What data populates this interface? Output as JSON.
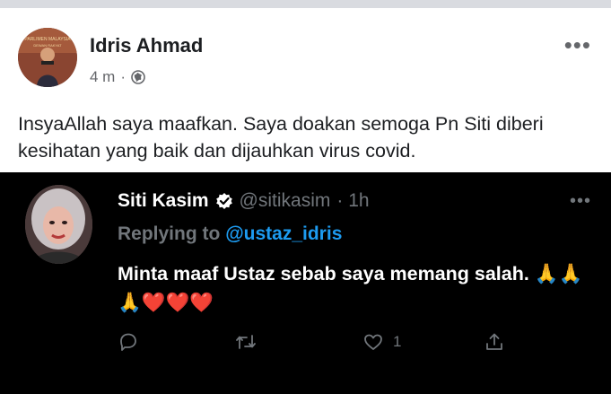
{
  "fb_post": {
    "author": "Idris Ahmad",
    "time": "4 m",
    "separator": "·",
    "audience_icon": "globe-icon",
    "more_icon": "more-horizontal-icon",
    "avatar_caption": "PARLIMEN MALAYSIA DEWAN RAKYAT",
    "text": "InsyaAllah  saya maafkan. Saya doakan semoga Pn Siti diberi kesihatan yang baik dan dijauhkan virus covid."
  },
  "tweet": {
    "name": "Siti Kasim",
    "verified_icon": "verified-badge-icon",
    "handle": "@sitikasim",
    "time": "· 1h",
    "replying_label": "Replying to",
    "replying_to": "@ustaz_idris",
    "text": "Minta maaf Ustaz sebab saya memang salah. 🙏🙏🙏❤️❤️❤️",
    "more_icon": "more-horizontal-icon",
    "actions": {
      "reply_icon": "reply-icon",
      "retweet_icon": "retweet-icon",
      "like_icon": "heart-icon",
      "like_count": "1",
      "share_icon": "share-icon"
    }
  },
  "colors": {
    "fb_text": "#1c1e21",
    "fb_secondary": "#65676b",
    "tw_background": "#000000",
    "tw_secondary": "#71767b",
    "tw_link": "#1d9bf0",
    "tw_verified": "#ffffff"
  }
}
